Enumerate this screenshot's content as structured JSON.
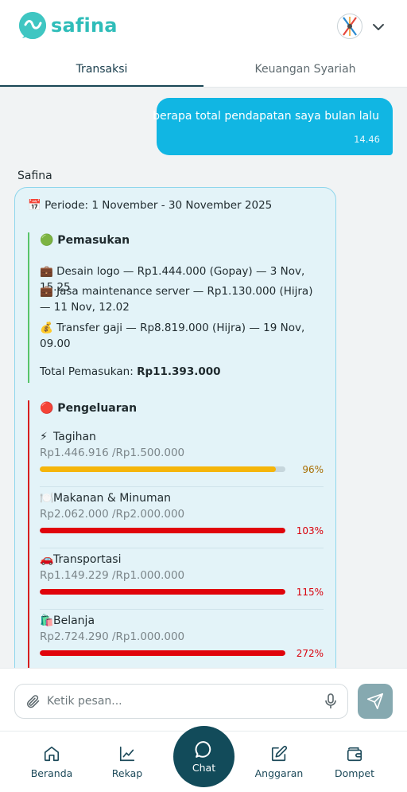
{
  "app": {
    "name": "safina"
  },
  "tabs": [
    {
      "label": "Transaksi",
      "active": true
    },
    {
      "label": "Keuangan Syariah",
      "active": false
    }
  ],
  "conversation": {
    "user_message": {
      "text": "berapa total pendapatan saya bulan lalu",
      "time": "14.46"
    },
    "bot": {
      "sender": "Safina",
      "periode_icon": "calendar-emoji",
      "periode": "📅 Periode: 1 November - 30 November 2025",
      "income": {
        "title": "🟢 Pemasukan",
        "items": [
          "💼 Desain logo — Rp1.444.000 (Gopay) — 3 Nov, 15.25",
          "💼 Jasa maintenance server — Rp1.130.000 (Hijra) — 11 Nov, 12.02",
          "💰 Transfer gaji — Rp8.819.000 (Hijra) — 19 Nov, 09.00"
        ],
        "total_label": "Total Pemasukan: ",
        "total_value": "Rp11.393.000"
      },
      "expense": {
        "title": "🔴 Pengeluaran",
        "items": [
          {
            "icon": "⚡",
            "name": "Tagihan",
            "amount": "Rp1.446.916 /Rp1.500.000",
            "percent": "96%",
            "ratio": 0.96,
            "color": "#f5b50a",
            "pct_color": "#a86d00"
          },
          {
            "icon": "🍽️",
            "name": "Makanan & Minuman",
            "amount": "Rp2.062.000 /Rp2.000.000",
            "percent": "103%",
            "ratio": 1.0,
            "color": "#e0040b",
            "pct_color": "#d9000b"
          },
          {
            "icon": "🚗",
            "name": "Transportasi",
            "amount": "Rp1.149.229 /Rp1.000.000",
            "percent": "115%",
            "ratio": 1.0,
            "color": "#e0040b",
            "pct_color": "#d9000b"
          },
          {
            "icon": "🛍️",
            "name": "Belanja",
            "amount": "Rp2.724.290 /Rp1.000.000",
            "percent": "272%",
            "ratio": 1.0,
            "color": "#e0040b",
            "pct_color": "#d9000b"
          }
        ]
      }
    }
  },
  "input": {
    "placeholder": "Ketik pesan...",
    "value": ""
  },
  "bottom_nav": [
    {
      "label": "Beranda",
      "icon": "home-icon"
    },
    {
      "label": "Rekap",
      "icon": "chart-line-icon"
    },
    {
      "label": "Chat",
      "icon": "chat-bubble-icon"
    },
    {
      "label": "Anggaran",
      "icon": "edit-icon"
    },
    {
      "label": "Dompet",
      "icon": "wallet-icon"
    }
  ],
  "colors": {
    "brand": "#2fbdb9",
    "primary_dark": "#124b5a",
    "user_bubble": "#11b6e3",
    "income_border": "#58c46a",
    "expense_border": "#d61f1f"
  }
}
